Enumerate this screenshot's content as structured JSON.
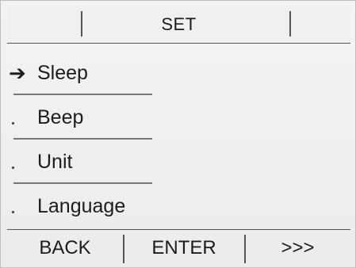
{
  "header": {
    "title": "SET"
  },
  "menu": {
    "items": [
      {
        "label": "Sleep",
        "marker": "➔",
        "selected": true
      },
      {
        "label": "Beep",
        "marker": "·",
        "selected": false
      },
      {
        "label": "Unit",
        "marker": "·",
        "selected": false
      },
      {
        "label": "Language",
        "marker": "·",
        "selected": false
      }
    ]
  },
  "footer": {
    "back_label": "BACK",
    "enter_label": "ENTER",
    "next_label": ">>>"
  },
  "colors": {
    "background": "#f1f1ef",
    "text": "#1c1c1c",
    "divider": "#555555"
  }
}
